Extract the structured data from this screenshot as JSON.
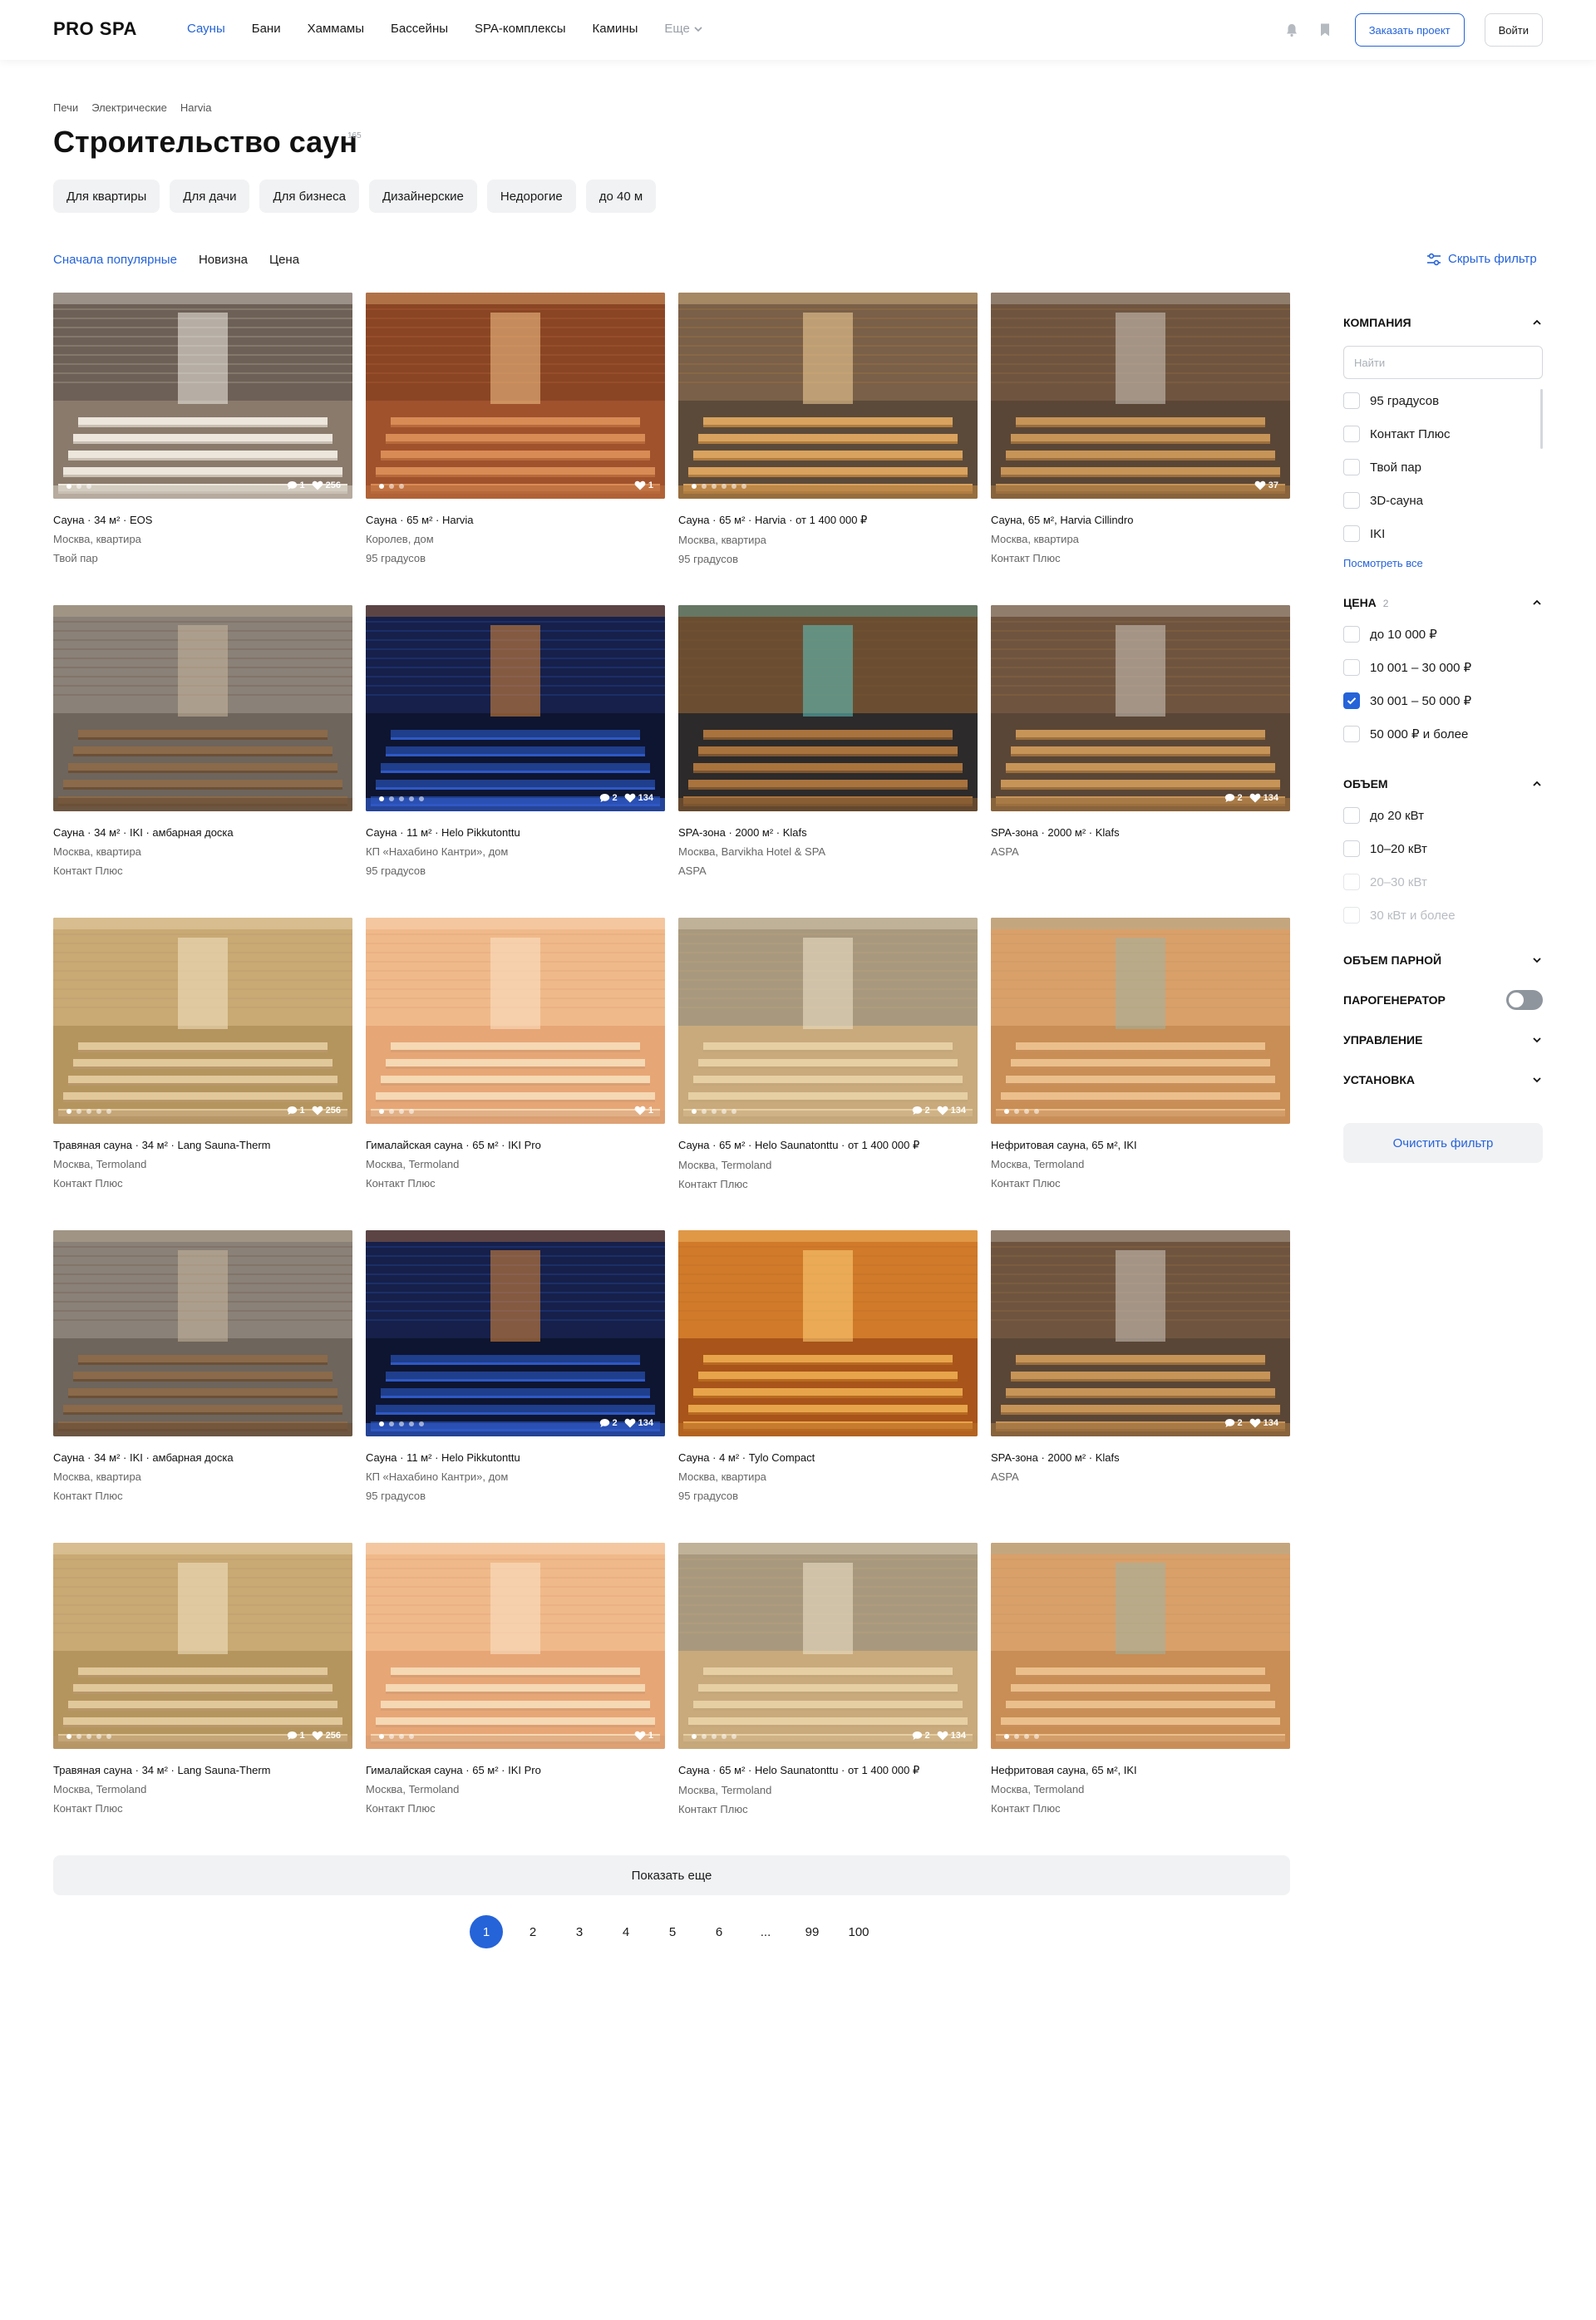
{
  "header": {
    "logo": "PRO SPA",
    "nav": [
      "Сауны",
      "Бани",
      "Хаммамы",
      "Бассейны",
      "SPA-комплексы",
      "Камины"
    ],
    "nav_more": "Еще",
    "order_button": "Заказать проект",
    "login_button": "Войти",
    "accent_color": "#2563d8"
  },
  "breadcrumb": [
    "Печи",
    "Электрические",
    "Harvia"
  ],
  "title": "Строительство саун",
  "title_count": "165",
  "chips": [
    "Для квартиры",
    "Для дачи",
    "Для бизнеса",
    "Дизайнерские",
    "Недорогие",
    "до 40 м"
  ],
  "sort": [
    "Сначала популярные",
    "Новизна",
    "Цена"
  ],
  "hide_filter": "Скрыть фильтр",
  "cards": [
    {
      "title": "Сауна · 34 м² · EOS",
      "location": "Москва, квартира",
      "company": "Твой пар",
      "comments": "1",
      "likes": "256",
      "dots": 3,
      "photo": "white"
    },
    {
      "title": "Сауна · 65 м² · Harvia",
      "location": "Королев, дом",
      "company": "95 градусов",
      "comments": "",
      "likes": "1",
      "dots": 3,
      "photo": "warm"
    },
    {
      "title": "Сауна · 65 м² · Harvia · от 1 400 000 ₽",
      "location": "Москва, квартира",
      "company": "95 градусов",
      "comments": "",
      "likes": "",
      "dots": 6,
      "photo": "amber"
    },
    {
      "title": "Сауна, 65 м², Harvia Cillindro",
      "location": "Москва, квартира",
      "company": "Контакт Плюс",
      "comments": "",
      "likes": "37",
      "dots": 0,
      "photo": "log"
    },
    {
      "title": "Сауна · 34 м² · IKI · амбарная доска",
      "location": "Москва, квартира",
      "company": "Контакт Плюс",
      "comments": "",
      "likes": "",
      "dots": 0,
      "photo": "stone"
    },
    {
      "title": "Сауна · 11 м² · Helo Pikkutonttu",
      "location": "КП «Нахабино Кантри», дом",
      "company": "95 градусов",
      "comments": "2",
      "likes": "134",
      "dots": 5,
      "photo": "blue"
    },
    {
      "title": "SPA-зона · 2000 м² · Klafs",
      "location": "Москва, Barvikha Hotel & SPA",
      "company": "ASPA",
      "comments": "",
      "likes": "",
      "dots": 0,
      "photo": "pool"
    },
    {
      "title": "SPA-зона · 2000 м² · Klafs",
      "location": "ASPA",
      "company": "",
      "comments": "2",
      "likes": "134",
      "dots": 0,
      "photo": "log"
    },
    {
      "title": "Травяная сауна · 34 м² · Lang Sauna-Therm",
      "location": "Москва, Termoland",
      "company": "Контакт Плюс",
      "comments": "1",
      "likes": "256",
      "dots": 5,
      "photo": "light"
    },
    {
      "title": "Гималайская сауна · 65 м² · IKI Pro",
      "location": "Москва, Termoland",
      "company": "Контакт Плюс",
      "comments": "",
      "likes": "1",
      "dots": 4,
      "photo": "salt"
    },
    {
      "title": "Сауна · 65 м² · Helo Saunatonttu · от 1 400 000 ₽",
      "location": "Москва, Termoland",
      "company": "Контакт Плюс",
      "comments": "2",
      "likes": "134",
      "dots": 5,
      "photo": "pale"
    },
    {
      "title": "Нефритовая сауна, 65 м², IKI",
      "location": "Москва, Termoland",
      "company": "Контакт Плюс",
      "comments": "",
      "likes": "",
      "dots": 4,
      "photo": "jade"
    },
    {
      "title": "Сауна · 34 м² · IKI · амбарная доска",
      "location": "Москва, квартира",
      "company": "Контакт Плюс",
      "comments": "",
      "likes": "",
      "dots": 0,
      "photo": "stone"
    },
    {
      "title": "Сауна · 11 м² · Helo Pikkutonttu",
      "location": "КП «Нахабино Кантри», дом",
      "company": "95 градусов",
      "comments": "2",
      "likes": "134",
      "dots": 5,
      "photo": "blue"
    },
    {
      "title": "Сауна · 4 м² · Tylo Compact",
      "location": "Москва, квартира",
      "company": "95 градусов",
      "comments": "",
      "likes": "",
      "dots": 0,
      "photo": "orange"
    },
    {
      "title": "SPA-зона · 2000 м² · Klafs",
      "location": "ASPA",
      "company": "",
      "comments": "2",
      "likes": "134",
      "dots": 0,
      "photo": "log"
    },
    {
      "title": "Травяная сауна · 34 м² · Lang Sauna-Therm",
      "location": "Москва, Termoland",
      "company": "Контакт Плюс",
      "comments": "1",
      "likes": "256",
      "dots": 5,
      "photo": "light"
    },
    {
      "title": "Гималайская сауна · 65 м² · IKI Pro",
      "location": "Москва, Termoland",
      "company": "Контакт Плюс",
      "comments": "",
      "likes": "1",
      "dots": 4,
      "photo": "salt"
    },
    {
      "title": "Сауна · 65 м² · Helo Saunatonttu · от 1 400 000 ₽",
      "location": "Москва, Termoland",
      "company": "Контакт Плюс",
      "comments": "2",
      "likes": "134",
      "dots": 5,
      "photo": "pale"
    },
    {
      "title": "Нефритовая сауна, 65 м², IKI",
      "location": "Москва, Termoland",
      "company": "Контакт Плюс",
      "comments": "",
      "likes": "",
      "dots": 4,
      "photo": "jade"
    }
  ],
  "load_more": "Показать еще",
  "pagination": [
    "1",
    "2",
    "3",
    "4",
    "5",
    "6",
    "...",
    "99",
    "100"
  ],
  "filter": {
    "company": {
      "title": "КОМПАНИЯ",
      "search_placeholder": "Найти",
      "items": [
        "95 градусов",
        "Контакт Плюс",
        "Твой пар",
        "3D-сауна",
        "IKI"
      ],
      "see_all": "Посмотреть все"
    },
    "price": {
      "title": "ЦЕНА",
      "count": "2",
      "items": [
        {
          "label": "до 10 000 ₽",
          "checked": false
        },
        {
          "label": "10 001 – 30 000 ₽",
          "checked": false
        },
        {
          "label": "30 001 – 50 000 ₽",
          "checked": true
        },
        {
          "label": "50 000 ₽ и более",
          "checked": false
        }
      ]
    },
    "volume": {
      "title": "ОБЪЕМ",
      "items": [
        {
          "label": "до 20 кВт",
          "disabled": false
        },
        {
          "label": "10–20 кВт",
          "disabled": false
        },
        {
          "label": "20–30 кВт",
          "disabled": true
        },
        {
          "label": "30 кВт и более",
          "disabled": true
        }
      ]
    },
    "steam_volume": "ОБЪЕМ ПАРНОЙ",
    "steam_generator": "ПАРОГЕНЕРАТОР",
    "control": "УПРАВЛЕНИЕ",
    "install": "УСТАНОВКА",
    "clear": "Очистить фильтр"
  }
}
